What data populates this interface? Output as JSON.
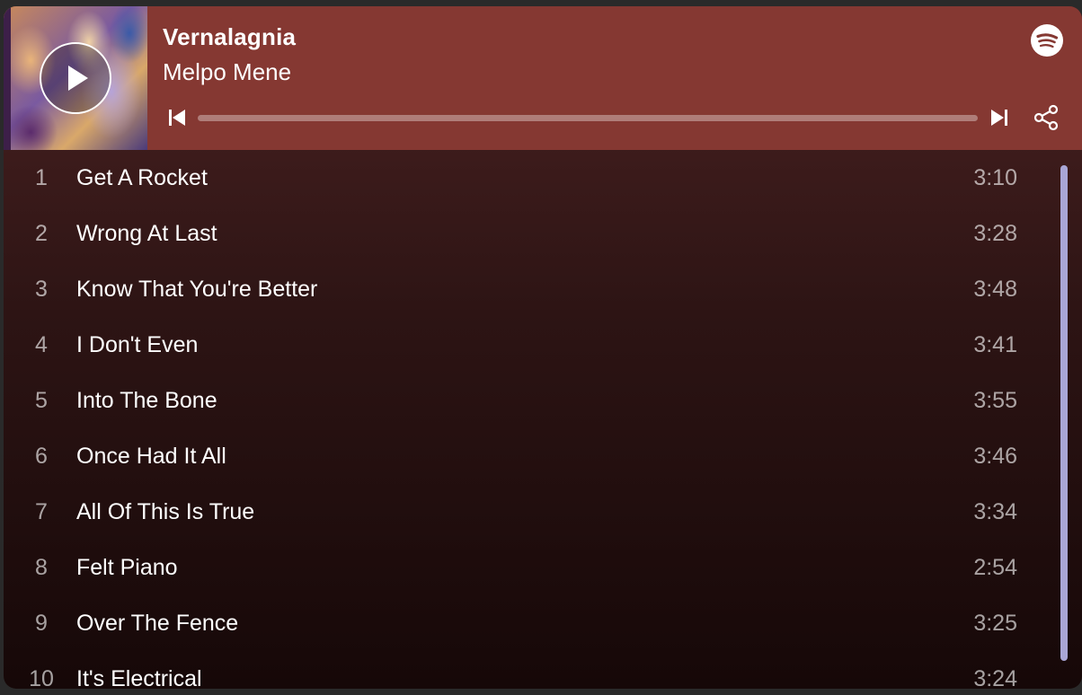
{
  "header": {
    "title": "Vernalagnia",
    "artist": "Melpo Mene",
    "progress_percent": 0,
    "background_color": "#853832"
  },
  "icons": {
    "play": "play-icon",
    "previous": "skip-previous-icon",
    "next": "skip-next-icon",
    "share": "share-icon",
    "brand": "spotify-logo-icon"
  },
  "tracks": [
    {
      "num": "1",
      "name": "Get A Rocket",
      "duration": "3:10"
    },
    {
      "num": "2",
      "name": "Wrong At Last",
      "duration": "3:28"
    },
    {
      "num": "3",
      "name": "Know That You're Better",
      "duration": "3:48"
    },
    {
      "num": "4",
      "name": "I Don't Even",
      "duration": "3:41"
    },
    {
      "num": "5",
      "name": "Into The Bone",
      "duration": "3:55"
    },
    {
      "num": "6",
      "name": "Once Had It All",
      "duration": "3:46"
    },
    {
      "num": "7",
      "name": "All Of This Is True",
      "duration": "3:34"
    },
    {
      "num": "8",
      "name": "Felt Piano",
      "duration": "2:54"
    },
    {
      "num": "9",
      "name": "Over The Fence",
      "duration": "3:25"
    },
    {
      "num": "10",
      "name": "It's Electrical",
      "duration": "3:24"
    }
  ]
}
